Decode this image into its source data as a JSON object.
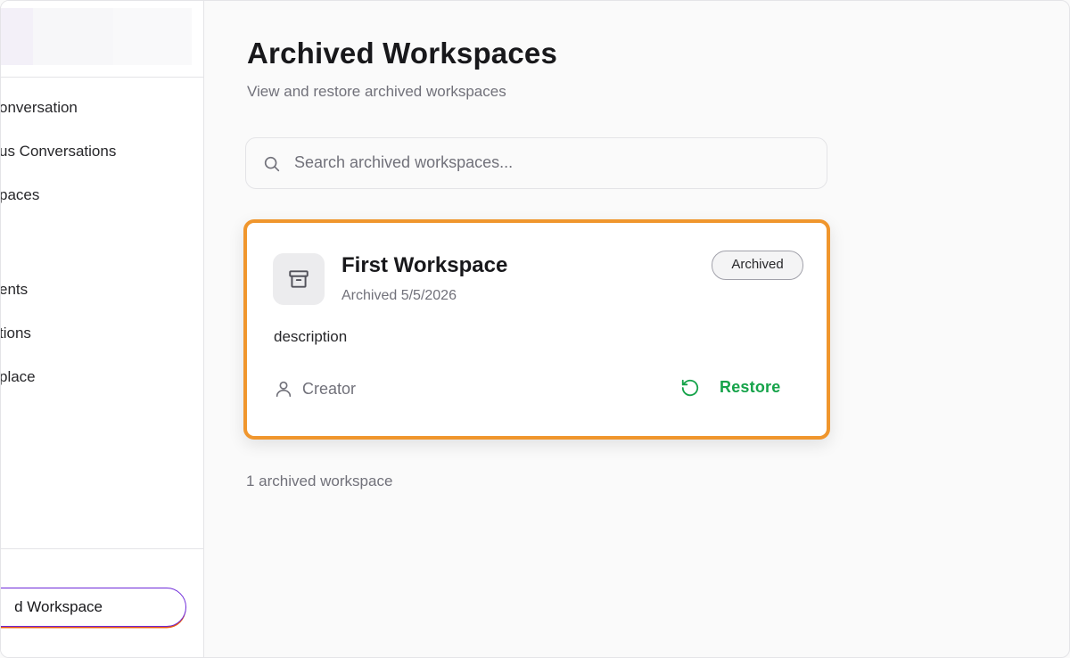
{
  "sidebar": {
    "items": [
      {
        "label": "onversation"
      },
      {
        "label": "us Conversations"
      },
      {
        "label": "paces"
      },
      {
        "label": "ents"
      },
      {
        "label": "tions"
      },
      {
        "label": "place"
      }
    ],
    "footer_button_label": "d Workspace"
  },
  "header": {
    "title": "Archived Workspaces",
    "subtitle": "View and restore archived workspaces"
  },
  "search": {
    "placeholder": "Search archived workspaces...",
    "value": ""
  },
  "workspaces": [
    {
      "name": "First Workspace",
      "archived_date": "Archived 5/5/2026",
      "badge": "Archived",
      "description": "description",
      "creator": "Creator",
      "restore_label": "Restore"
    }
  ],
  "count_text": "1 archived workspace",
  "colors": {
    "accent_green": "#16a34a",
    "highlight_orange": "#f0962d",
    "brand_purple": "#6d28d9"
  },
  "icons": {
    "search": "search-icon",
    "archive": "archive-box-icon",
    "user": "user-icon",
    "restore": "rotate-ccw-icon"
  }
}
